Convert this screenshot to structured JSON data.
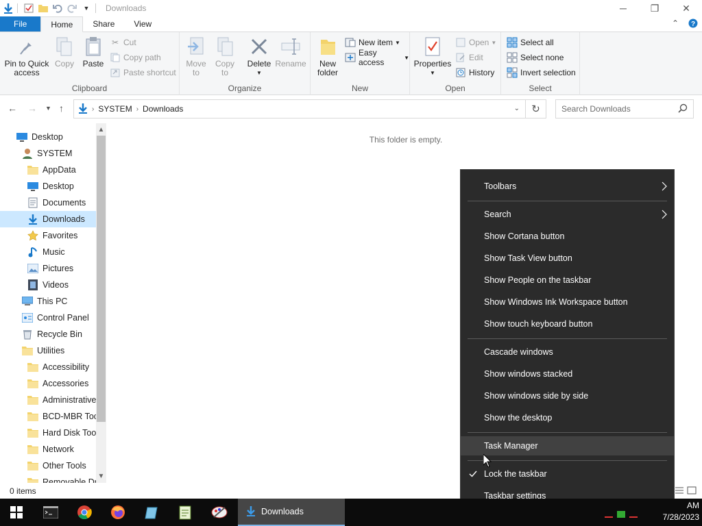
{
  "window": {
    "title": "Downloads"
  },
  "ribbon_tabs": {
    "file": "File",
    "home": "Home",
    "share": "Share",
    "view": "View"
  },
  "ribbon": {
    "clipboard": {
      "label": "Clipboard",
      "pin": [
        "Pin to Quick",
        "access"
      ],
      "copy": "Copy",
      "paste": "Paste",
      "cut": "Cut",
      "copy_path": "Copy path",
      "paste_shortcut": "Paste shortcut"
    },
    "organize": {
      "label": "Organize",
      "move_to": [
        "Move",
        "to"
      ],
      "copy_to": [
        "Copy",
        "to"
      ],
      "delete": "Delete",
      "rename": "Rename"
    },
    "new": {
      "label": "New",
      "new_folder": [
        "New",
        "folder"
      ],
      "new_item": "New item",
      "easy_access": "Easy access"
    },
    "open": {
      "label": "Open",
      "properties": "Properties",
      "open": "Open",
      "edit": "Edit",
      "history": "History"
    },
    "select": {
      "label": "Select",
      "select_all": "Select all",
      "select_none": "Select none",
      "invert_selection": "Invert selection"
    }
  },
  "address": {
    "crumbs": [
      "SYSTEM",
      "Downloads"
    ],
    "search_placeholder": "Search Downloads"
  },
  "nav_pane": {
    "items": [
      {
        "label": "Desktop",
        "icon": "desktop-icon",
        "indent": 0
      },
      {
        "label": "SYSTEM",
        "icon": "user-icon",
        "indent": 1
      },
      {
        "label": "AppData",
        "icon": "folder-icon",
        "indent": 2
      },
      {
        "label": "Desktop",
        "icon": "desktop-icon",
        "indent": 2
      },
      {
        "label": "Documents",
        "icon": "documents-icon",
        "indent": 2
      },
      {
        "label": "Downloads",
        "icon": "downloads-icon",
        "indent": 2,
        "selected": true
      },
      {
        "label": "Favorites",
        "icon": "star-icon",
        "indent": 2
      },
      {
        "label": "Music",
        "icon": "music-icon",
        "indent": 2
      },
      {
        "label": "Pictures",
        "icon": "pictures-icon",
        "indent": 2
      },
      {
        "label": "Videos",
        "icon": "videos-icon",
        "indent": 2
      },
      {
        "label": "This PC",
        "icon": "pc-icon",
        "indent": 1
      },
      {
        "label": "Control Panel",
        "icon": "control-panel-icon",
        "indent": 1
      },
      {
        "label": "Recycle Bin",
        "icon": "recycle-bin-icon",
        "indent": 1
      },
      {
        "label": "Utilities",
        "icon": "folder-icon",
        "indent": 1
      },
      {
        "label": "Accessibility",
        "icon": "folder-icon",
        "indent": 2
      },
      {
        "label": "Accessories",
        "icon": "folder-icon",
        "indent": 2
      },
      {
        "label": "Administrative",
        "icon": "folder-icon",
        "indent": 2
      },
      {
        "label": "BCD-MBR Tool",
        "icon": "folder-icon",
        "indent": 2
      },
      {
        "label": "Hard Disk Tools",
        "icon": "folder-icon",
        "indent": 2
      },
      {
        "label": "Network",
        "icon": "folder-icon",
        "indent": 2
      },
      {
        "label": "Other Tools",
        "icon": "folder-icon",
        "indent": 2
      },
      {
        "label": "Removable Dri",
        "icon": "folder-icon",
        "indent": 2
      }
    ]
  },
  "content": {
    "empty_message": "This folder is empty."
  },
  "status": {
    "items_count": "0 items"
  },
  "context_menu": {
    "items": [
      {
        "label": "Toolbars",
        "submenu": true
      },
      {
        "label": "Search",
        "submenu": true
      },
      {
        "label": "Show Cortana button"
      },
      {
        "label": "Show Task View button"
      },
      {
        "label": "Show People on the taskbar"
      },
      {
        "label": "Show Windows Ink Workspace button"
      },
      {
        "label": "Show touch keyboard button"
      },
      {
        "label": "Cascade windows"
      },
      {
        "label": "Show windows stacked"
      },
      {
        "label": "Show windows side by side"
      },
      {
        "label": "Show the desktop"
      },
      {
        "label": "Task Manager",
        "hover": true
      },
      {
        "label": "Lock the taskbar",
        "checked": true
      },
      {
        "label": "Taskbar settings"
      }
    ]
  },
  "taskbar": {
    "active_window": "Downloads",
    "clock_time": "AM",
    "clock_date": "7/28/2023"
  },
  "colors": {
    "accent": "#1979ca",
    "selection": "#cce8ff",
    "menu_bg": "#2b2b2b",
    "taskbar_bg": "#0c0c0c"
  }
}
